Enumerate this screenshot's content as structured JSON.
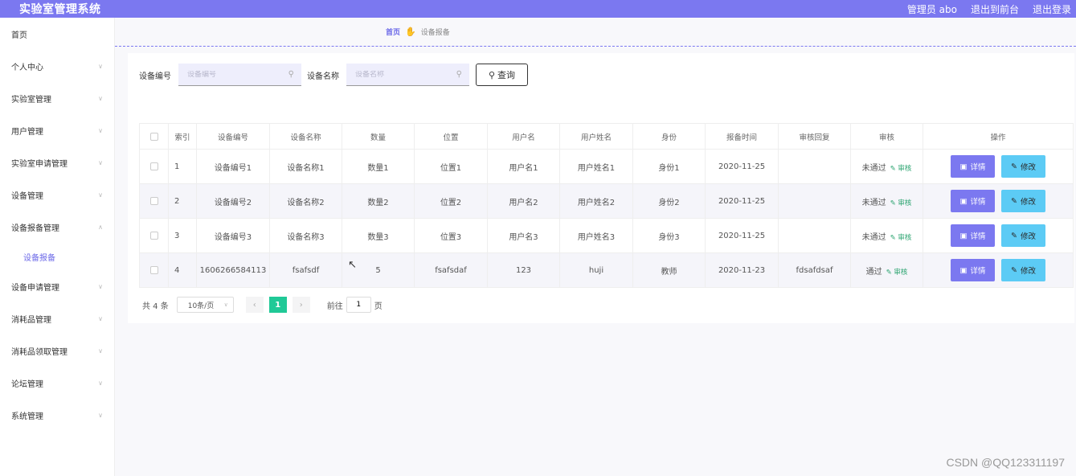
{
  "header": {
    "title": "实验室管理系统",
    "admin_label": "管理员 abo",
    "to_front": "退出到前台",
    "logout": "退出登录"
  },
  "sidebar": {
    "items": [
      {
        "label": "首页",
        "chevron": false
      },
      {
        "label": "个人中心",
        "chevron": true
      },
      {
        "label": "实验室管理",
        "chevron": true
      },
      {
        "label": "用户管理",
        "chevron": true
      },
      {
        "label": "实验室申请管理",
        "chevron": true
      },
      {
        "label": "设备管理",
        "chevron": true
      },
      {
        "label": "设备报备管理",
        "chevron": true,
        "expanded": true
      },
      {
        "label": "设备申请管理",
        "chevron": true
      },
      {
        "label": "消耗品管理",
        "chevron": true
      },
      {
        "label": "消耗品领取管理",
        "chevron": true
      },
      {
        "label": "论坛管理",
        "chevron": true
      },
      {
        "label": "系统管理",
        "chevron": true
      }
    ],
    "sub_active": "设备报备"
  },
  "breadcrumb": {
    "home": "首页",
    "current": "设备报备"
  },
  "search": {
    "code_label": "设备编号",
    "code_placeholder": "设备编号",
    "name_label": "设备名称",
    "name_placeholder": "设备名称",
    "query_label": "查询"
  },
  "table": {
    "headers": [
      "索引",
      "设备编号",
      "设备名称",
      "数量",
      "位置",
      "用户名",
      "用户姓名",
      "身份",
      "报备时间",
      "审核回复",
      "审核",
      "操作"
    ],
    "rows": [
      {
        "index": "1",
        "code": "设备编号1",
        "name": "设备名称1",
        "qty": "数量1",
        "pos": "位置1",
        "user": "用户名1",
        "uname": "用户姓名1",
        "role": "身份1",
        "time": "2020-11-25",
        "reply": "",
        "status": "未通过"
      },
      {
        "index": "2",
        "code": "设备编号2",
        "name": "设备名称2",
        "qty": "数量2",
        "pos": "位置2",
        "user": "用户名2",
        "uname": "用户姓名2",
        "role": "身份2",
        "time": "2020-11-25",
        "reply": "",
        "status": "未通过"
      },
      {
        "index": "3",
        "code": "设备编号3",
        "name": "设备名称3",
        "qty": "数量3",
        "pos": "位置3",
        "user": "用户名3",
        "uname": "用户姓名3",
        "role": "身份3",
        "time": "2020-11-25",
        "reply": "",
        "status": "未通过"
      },
      {
        "index": "4",
        "code": "1606266584113",
        "name": "fsafsdf",
        "qty": "5",
        "pos": "fsafsdaf",
        "user": "123",
        "uname": "huji",
        "role": "教师",
        "time": "2020-11-23",
        "reply": "fdsafdsaf",
        "status": "通过"
      }
    ],
    "audit_link": "审核",
    "detail_label": "详情",
    "edit_label": "修改"
  },
  "pagination": {
    "total": "共 4 条",
    "page_size": "10条/页",
    "current_page": "1",
    "goto_prefix": "前往",
    "goto_value": "1",
    "goto_suffix": "页"
  },
  "watermark": "CSDN @QQ123311197",
  "colors": {
    "primary": "#7b78f0",
    "edit": "#5ccbf5",
    "active_page": "#20c997",
    "audit_link": "#2aa36f"
  }
}
